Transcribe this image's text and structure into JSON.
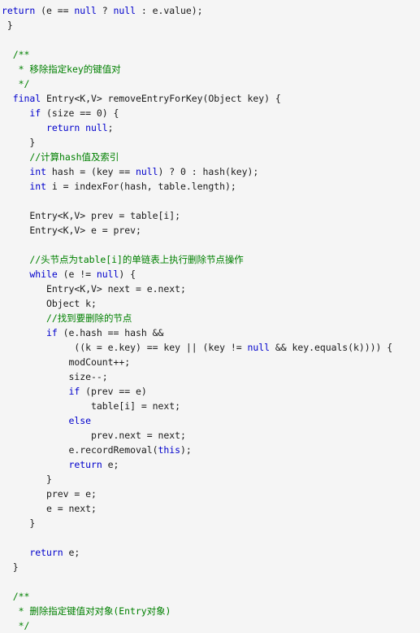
{
  "editor": {
    "language": "java",
    "background_color": "#f5f5f5",
    "keyword_color": "#0000CC",
    "comment_color": "#008000",
    "text_color": "#000000"
  },
  "code_lines": [
    {
      "indent": 0,
      "tokens": [
        {
          "t": "kw",
          "s": "return"
        },
        {
          "t": "txt",
          "s": " ("
        },
        {
          "t": "txt",
          "s": "e == "
        },
        {
          "t": "kw",
          "s": "null"
        },
        {
          "t": "txt",
          "s": " ? "
        },
        {
          "t": "kw",
          "s": "null"
        },
        {
          "t": "txt",
          "s": " : e.value);"
        }
      ]
    },
    {
      "indent": 1,
      "tokens": [
        {
          "t": "txt",
          "s": "}"
        }
      ]
    },
    {
      "indent": 0,
      "tokens": []
    },
    {
      "indent": 2,
      "tokens": [
        {
          "t": "com",
          "s": "/**"
        }
      ]
    },
    {
      "indent": 3,
      "tokens": [
        {
          "t": "com",
          "s": "* 移除指定key的键值对"
        }
      ]
    },
    {
      "indent": 3,
      "tokens": [
        {
          "t": "com",
          "s": "*/"
        }
      ]
    },
    {
      "indent": 2,
      "tokens": [
        {
          "t": "kw",
          "s": "final"
        },
        {
          "t": "txt",
          "s": " Entry<K,V> removeEntryForKey(Object key) {"
        }
      ]
    },
    {
      "indent": 5,
      "tokens": [
        {
          "t": "kw",
          "s": "if"
        },
        {
          "t": "txt",
          "s": " (size == 0) {"
        }
      ]
    },
    {
      "indent": 8,
      "tokens": [
        {
          "t": "kw",
          "s": "return"
        },
        {
          "t": "txt",
          "s": " "
        },
        {
          "t": "kw",
          "s": "null"
        },
        {
          "t": "txt",
          "s": ";"
        }
      ]
    },
    {
      "indent": 5,
      "tokens": [
        {
          "t": "txt",
          "s": "}"
        }
      ]
    },
    {
      "indent": 5,
      "tokens": [
        {
          "t": "com",
          "s": "//计算hash值及索引"
        }
      ]
    },
    {
      "indent": 5,
      "tokens": [
        {
          "t": "kw",
          "s": "int"
        },
        {
          "t": "txt",
          "s": " hash = (key == "
        },
        {
          "t": "kw",
          "s": "null"
        },
        {
          "t": "txt",
          "s": ") ? 0 : hash(key);"
        }
      ]
    },
    {
      "indent": 5,
      "tokens": [
        {
          "t": "kw",
          "s": "int"
        },
        {
          "t": "txt",
          "s": " i = indexFor(hash, table.length);"
        }
      ]
    },
    {
      "indent": 0,
      "tokens": []
    },
    {
      "indent": 5,
      "tokens": [
        {
          "t": "txt",
          "s": "Entry<K,V> prev = table[i];"
        }
      ]
    },
    {
      "indent": 5,
      "tokens": [
        {
          "t": "txt",
          "s": "Entry<K,V> e = prev;"
        }
      ]
    },
    {
      "indent": 0,
      "tokens": []
    },
    {
      "indent": 5,
      "tokens": [
        {
          "t": "com",
          "s": "//头节点为table[i]的单链表上执行删除节点操作"
        }
      ]
    },
    {
      "indent": 5,
      "tokens": [
        {
          "t": "kw",
          "s": "while"
        },
        {
          "t": "txt",
          "s": " (e != "
        },
        {
          "t": "kw",
          "s": "null"
        },
        {
          "t": "txt",
          "s": ") {"
        }
      ]
    },
    {
      "indent": 8,
      "tokens": [
        {
          "t": "txt",
          "s": "Entry<K,V> next = e.next;"
        }
      ]
    },
    {
      "indent": 8,
      "tokens": [
        {
          "t": "txt",
          "s": "Object k;"
        }
      ]
    },
    {
      "indent": 8,
      "tokens": [
        {
          "t": "com",
          "s": "//找到要删除的节点"
        }
      ]
    },
    {
      "indent": 8,
      "tokens": [
        {
          "t": "kw",
          "s": "if"
        },
        {
          "t": "txt",
          "s": " (e.hash == hash &&"
        }
      ]
    },
    {
      "indent": 13,
      "tokens": [
        {
          "t": "txt",
          "s": "((k = e.key) == key || (key != "
        },
        {
          "t": "kw",
          "s": "null"
        },
        {
          "t": "txt",
          "s": " && key.equals(k)))) {"
        }
      ]
    },
    {
      "indent": 12,
      "tokens": [
        {
          "t": "txt",
          "s": "modCount++;"
        }
      ]
    },
    {
      "indent": 12,
      "tokens": [
        {
          "t": "txt",
          "s": "size--;"
        }
      ]
    },
    {
      "indent": 12,
      "tokens": [
        {
          "t": "kw",
          "s": "if"
        },
        {
          "t": "txt",
          "s": " (prev == e)"
        }
      ]
    },
    {
      "indent": 16,
      "tokens": [
        {
          "t": "txt",
          "s": "table[i] = next;"
        }
      ]
    },
    {
      "indent": 12,
      "tokens": [
        {
          "t": "kw",
          "s": "else"
        }
      ]
    },
    {
      "indent": 16,
      "tokens": [
        {
          "t": "txt",
          "s": "prev.next = next;"
        }
      ]
    },
    {
      "indent": 12,
      "tokens": [
        {
          "t": "txt",
          "s": "e.recordRemoval("
        },
        {
          "t": "kw",
          "s": "this"
        },
        {
          "t": "txt",
          "s": ");"
        }
      ]
    },
    {
      "indent": 12,
      "tokens": [
        {
          "t": "kw",
          "s": "return"
        },
        {
          "t": "txt",
          "s": " e;"
        }
      ]
    },
    {
      "indent": 8,
      "tokens": [
        {
          "t": "txt",
          "s": "}"
        }
      ]
    },
    {
      "indent": 8,
      "tokens": [
        {
          "t": "txt",
          "s": "prev = e;"
        }
      ]
    },
    {
      "indent": 8,
      "tokens": [
        {
          "t": "txt",
          "s": "e = next;"
        }
      ]
    },
    {
      "indent": 5,
      "tokens": [
        {
          "t": "txt",
          "s": "}"
        }
      ]
    },
    {
      "indent": 0,
      "tokens": []
    },
    {
      "indent": 5,
      "tokens": [
        {
          "t": "kw",
          "s": "return"
        },
        {
          "t": "txt",
          "s": " e;"
        }
      ]
    },
    {
      "indent": 2,
      "tokens": [
        {
          "t": "txt",
          "s": "}"
        }
      ]
    },
    {
      "indent": 0,
      "tokens": []
    },
    {
      "indent": 2,
      "tokens": [
        {
          "t": "com",
          "s": "/**"
        }
      ]
    },
    {
      "indent": 3,
      "tokens": [
        {
          "t": "com",
          "s": "* 删除指定键值对对象(Entry对象)"
        }
      ]
    },
    {
      "indent": 3,
      "tokens": [
        {
          "t": "com",
          "s": "*/"
        }
      ]
    }
  ]
}
